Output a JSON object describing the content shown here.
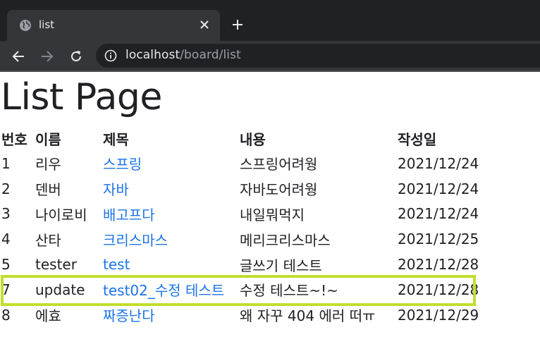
{
  "browser": {
    "tab_title": "list",
    "url_host": "localhost",
    "url_path": "/board/list"
  },
  "page": {
    "title": "List Page",
    "headers": {
      "no": "번호",
      "name": "이름",
      "title": "제목",
      "content": "내용",
      "date": "작성일"
    },
    "rows": [
      {
        "no": "1",
        "name": "리우",
        "title": "스프링",
        "content": "스프링어려웡",
        "date": "2021/12/24"
      },
      {
        "no": "2",
        "name": "덴버",
        "title": "자바",
        "content": "자바도어려웡",
        "date": "2021/12/24"
      },
      {
        "no": "3",
        "name": "나이로비",
        "title": "배고프다",
        "content": "내일뭐먹지",
        "date": "2021/12/24"
      },
      {
        "no": "4",
        "name": "산타",
        "title": "크리스마스",
        "content": "메리크리스마스",
        "date": "2021/12/25"
      },
      {
        "no": "5",
        "name": "tester",
        "title": "test",
        "content": "글쓰기 테스트",
        "date": "2021/12/28"
      },
      {
        "no": "7",
        "name": "update",
        "title": "test02_수정 테스트",
        "content": "수정 테스트~!~",
        "date": "2021/12/28"
      },
      {
        "no": "8",
        "name": "에효",
        "title": "짜증난다",
        "content": "왜 자꾸 404 에러 떠ㅠ",
        "date": "2021/12/29"
      }
    ]
  },
  "colors": {
    "highlight_border": "#c1dd2e",
    "link": "#1a73e8"
  }
}
